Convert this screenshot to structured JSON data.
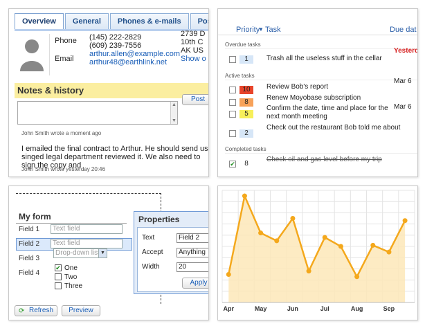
{
  "contact": {
    "tabs": [
      "Overview",
      "General",
      "Phones & e-mails",
      "Postal ad"
    ],
    "phone_label": "Phone",
    "phones": [
      "(145) 222-2829",
      "(609) 239-7556"
    ],
    "email_label": "Email",
    "emails": [
      "arthur.allen@example.com",
      "arthur48@earthlink.net"
    ],
    "address": [
      "2739 D",
      "10th C",
      "AK US",
      "Show o"
    ],
    "notes_title": "Notes & history",
    "post_label": "Post",
    "note1_meta": "John Smith wrote a moment ago",
    "note1_text": "I emailed the final contract to Arthur. He should send us a singed legal department reviewed it. We also need to sign the copy and",
    "note2_meta": "John Smith wrote yesterday 20:46"
  },
  "tasks": {
    "col_priority": "Priority",
    "col_task": "Task",
    "col_due": "Due dat",
    "overdue_label": "Overdue tasks",
    "active_label": "Active tasks",
    "completed_label": "Completed tasks",
    "overdue": [
      {
        "priority": "1",
        "text": "Trash all the useless stuff in the cellar",
        "due": "Yesterd",
        "color": "#d6e6f7"
      }
    ],
    "active": [
      {
        "priority": "10",
        "text": "Review Bob's report",
        "due": "Mar 6",
        "color": "#e8442a"
      },
      {
        "priority": "8",
        "text": "Renew Moyobase subscription",
        "due": "",
        "color": "#f7a25a"
      },
      {
        "priority": "5",
        "text": "Confirm the date, time and place for the next month meeting",
        "due": "Mar 6",
        "color": "#f7ef5a"
      },
      {
        "priority": "2",
        "text": "Check out the restaurant Bob told me about",
        "due": "",
        "color": "#d6e6f7"
      }
    ],
    "completed": [
      {
        "priority": "8",
        "text": "Check oil and gas level before my trip",
        "done": true
      }
    ],
    "colors": {
      "overdue_due": "#d62020"
    }
  },
  "form": {
    "title": "My form",
    "fields": [
      {
        "label": "Field 1",
        "placeholder": "Text field"
      },
      {
        "label": "Field 2",
        "placeholder": "Text field"
      },
      {
        "label": "Field 3",
        "placeholder": "Drop-down list"
      },
      {
        "label": "Field 4"
      }
    ],
    "checkboxes": [
      {
        "label": "One",
        "checked": true
      },
      {
        "label": "Two",
        "checked": false
      },
      {
        "label": "Three",
        "checked": false
      }
    ],
    "properties_title": "Properties",
    "props": [
      {
        "label": "Text",
        "value": "Field 2"
      },
      {
        "label": "Accept",
        "value": "Anything"
      },
      {
        "label": "Width",
        "value": "20"
      }
    ],
    "apply_label": "Apply",
    "refresh_label": "Refresh",
    "preview_label": "Preview"
  },
  "chart_data": {
    "type": "area",
    "categories": [
      "Apr",
      "May",
      "Jun",
      "Jul",
      "Aug",
      "Sep"
    ],
    "x": [
      0,
      0.5,
      1,
      1.5,
      2,
      2.5,
      3,
      3.5,
      4,
      4.5,
      5,
      5.5
    ],
    "values": [
      0.25,
      0.95,
      0.62,
      0.55,
      0.75,
      0.28,
      0.58,
      0.5,
      0.23,
      0.51,
      0.45,
      0.73
    ],
    "ylim": [
      0,
      1
    ],
    "grid": true,
    "colors": {
      "line": "#f4a81c",
      "fill": "#fde7b8",
      "grid": "#e4e4e4"
    }
  }
}
